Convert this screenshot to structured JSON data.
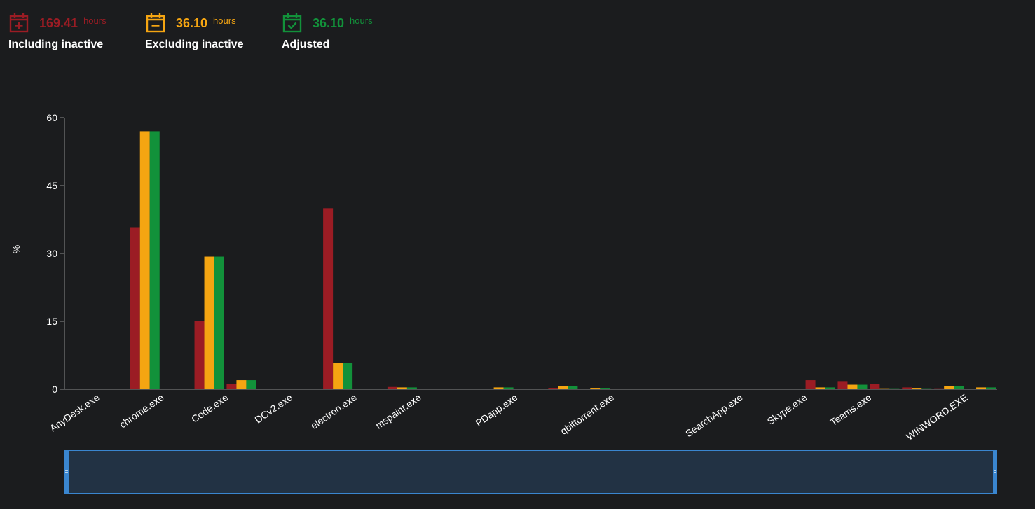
{
  "stats": [
    {
      "value": "169.41",
      "unit": "hours",
      "label": "Including inactive",
      "color": "#9b1c24",
      "icon": "calendar-plus-icon"
    },
    {
      "value": "36.10",
      "unit": "hours",
      "label": "Excluding inactive",
      "color": "#f5a512",
      "icon": "calendar-minus-icon"
    },
    {
      "value": "36.10",
      "unit": "hours",
      "label": "Adjusted",
      "color": "#12913a",
      "icon": "calendar-check-icon"
    }
  ],
  "chart_data": {
    "type": "bar",
    "ylabel": "%",
    "ylim": [
      0,
      60
    ],
    "yticks": [
      0,
      15,
      30,
      45,
      60
    ],
    "grid": false,
    "categories": [
      "AnyDesk.exe",
      "",
      "chrome.exe",
      "",
      "Code.exe",
      "",
      "DCv2.exe",
      "",
      "electron.exe",
      "",
      "mspaint.exe",
      "",
      "",
      "PDapp.exe",
      "",
      "",
      "qbittorrent.exe",
      "",
      "",
      "",
      "SearchApp.exe",
      "",
      "Skype.exe",
      "",
      "Teams.exe",
      "",
      "",
      "WINWORD.EXE",
      ""
    ],
    "series": [
      {
        "color": "#9b1c24",
        "values": [
          0.05,
          0.05,
          35.8,
          0.05,
          15.0,
          1.2,
          0,
          0,
          40.0,
          0,
          0.5,
          0,
          0,
          0.1,
          0,
          0.3,
          0,
          0,
          0,
          0,
          0,
          0,
          0.1,
          2.0,
          1.8,
          1.2,
          0.4,
          0.2,
          0.1
        ]
      },
      {
        "color": "#f5a512",
        "values": [
          0,
          0.05,
          57.0,
          0,
          29.3,
          2.0,
          0,
          0,
          5.8,
          0,
          0.4,
          0,
          0,
          0.4,
          0,
          0.7,
          0.3,
          0,
          0,
          0,
          0,
          0,
          0.1,
          0.4,
          1.0,
          0.2,
          0.3,
          0.7,
          0.4
        ]
      },
      {
        "color": "#12913a",
        "values": [
          0,
          0,
          57.0,
          0,
          29.3,
          2.0,
          0,
          0,
          5.8,
          0,
          0.4,
          0,
          0,
          0.4,
          0,
          0.7,
          0.3,
          0,
          0,
          0,
          0,
          0,
          0.1,
          0.4,
          1.0,
          0.2,
          0.2,
          0.7,
          0.4
        ]
      }
    ]
  }
}
